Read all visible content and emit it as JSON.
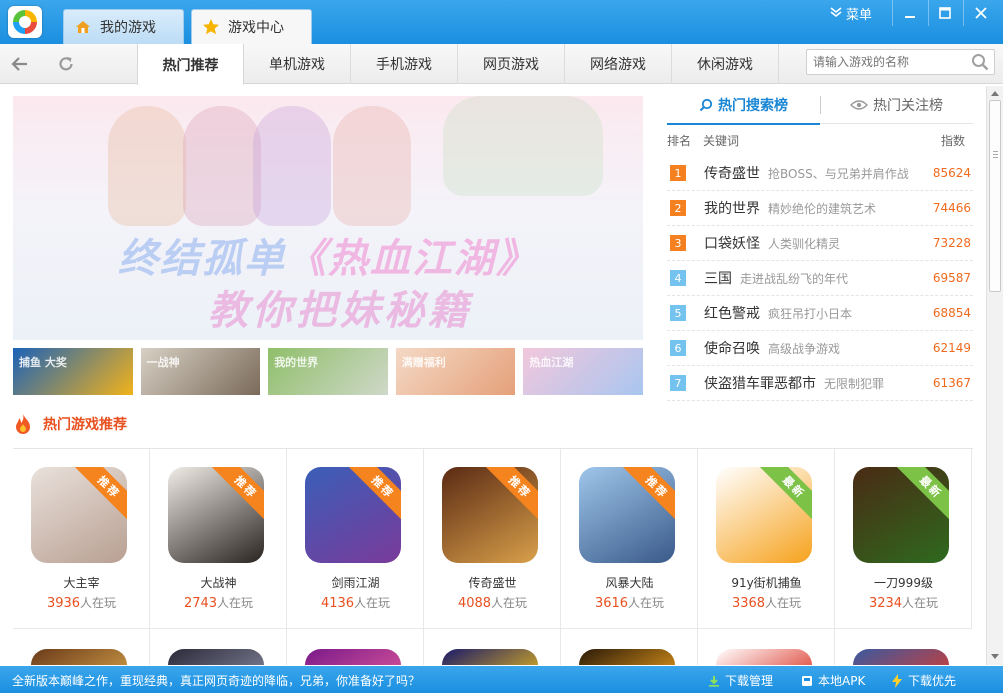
{
  "titlebar": {
    "tabs": [
      {
        "label": "我的游戏"
      },
      {
        "label": "游戏中心"
      }
    ],
    "menu_label": "菜单"
  },
  "nav": {
    "tabs": [
      "热门推荐",
      "单机游戏",
      "手机游戏",
      "网页游戏",
      "网络游戏",
      "休闲游戏"
    ],
    "search_placeholder": "请输入游戏的名称"
  },
  "banner": {
    "line1_a": "终结孤单",
    "line1_b": "《热血江湖》",
    "line2": "教你把妹秘籍"
  },
  "thumbs": [
    {
      "text": "捕鱼 大奖",
      "color1": "#1b62b8",
      "color2": "#f2b21a"
    },
    {
      "text": "一战神",
      "color1": "#d7d0c4",
      "color2": "#7a6a5a"
    },
    {
      "text": "我的世界",
      "color1": "#8fbf6a",
      "color2": "#cfd8c8"
    },
    {
      "text": "满赠福利",
      "color1": "#f4d9c5",
      "color2": "#e5a07a"
    },
    {
      "text": "热血江湖",
      "color1": "#f2c7dc",
      "color2": "#a9c6ef"
    }
  ],
  "ranking": {
    "tab_active": "热门搜索榜",
    "tab_inactive": "热门关注榜",
    "col_rank": "排名",
    "col_keyword": "关键词",
    "col_index": "指数",
    "items": [
      {
        "rank": "1",
        "name": "传奇盛世",
        "desc": "抢BOSS、与兄弟并肩作战",
        "score": "85624",
        "hot": true
      },
      {
        "rank": "2",
        "name": "我的世界",
        "desc": "精妙绝伦的建筑艺术",
        "score": "74466",
        "hot": true
      },
      {
        "rank": "3",
        "name": "口袋妖怪",
        "desc": "人类驯化精灵",
        "score": "73228",
        "hot": true
      },
      {
        "rank": "4",
        "name": "三国",
        "desc": "走进战乱纷飞的年代",
        "score": "69587",
        "hot": false
      },
      {
        "rank": "5",
        "name": "红色警戒",
        "desc": "疯狂吊打小日本",
        "score": "68854",
        "hot": false
      },
      {
        "rank": "6",
        "name": "使命召唤",
        "desc": "高级战争游戏",
        "score": "62149",
        "hot": false
      },
      {
        "rank": "7",
        "name": "侠盗猎车罪恶都市",
        "desc": "无限制犯罪",
        "score": "61367",
        "hot": false
      }
    ]
  },
  "hot": {
    "title": "热门游戏推荐",
    "playing_suffix": "人在玩",
    "games": [
      {
        "name": "大主宰",
        "count": "3936",
        "ribbon": "推荐",
        "ribbon_type": "rec",
        "c1": "#e9e1db",
        "c2": "#b89f92"
      },
      {
        "name": "大战神",
        "count": "2743",
        "ribbon": "推荐",
        "ribbon_type": "rec",
        "c1": "#f0ece6",
        "c2": "#2a2420"
      },
      {
        "name": "剑雨江湖",
        "count": "4136",
        "ribbon": "推荐",
        "ribbon_type": "rec",
        "c1": "#3a5fb8",
        "c2": "#7a3a9a"
      },
      {
        "name": "传奇盛世",
        "count": "4088",
        "ribbon": "推荐",
        "ribbon_type": "rec",
        "c1": "#5a2a14",
        "c2": "#d9a04a"
      },
      {
        "name": "风暴大陆",
        "count": "3616",
        "ribbon": "推荐",
        "ribbon_type": "rec",
        "c1": "#9fc6ea",
        "c2": "#3a5a8a"
      },
      {
        "name": "91y街机捕鱼",
        "count": "3368",
        "ribbon": "最新",
        "ribbon_type": "new",
        "c1": "#ffffff",
        "c2": "#f6a21c"
      },
      {
        "name": "一刀999级",
        "count": "3234",
        "ribbon": "最新",
        "ribbon_type": "new",
        "c1": "#4a2a14",
        "c2": "#2e6a1e"
      }
    ],
    "row2_colors": [
      {
        "c1": "#6a3a1a",
        "c2": "#d9a64a"
      },
      {
        "c1": "#2a2a3a",
        "c2": "#8a8aa0"
      },
      {
        "c1": "#7a1a8a",
        "c2": "#e05a9a"
      },
      {
        "c1": "#1a1a6a",
        "c2": "#f2c21a"
      },
      {
        "c1": "#2a1a0a",
        "c2": "#f2a21a"
      },
      {
        "c1": "#ffffff",
        "c2": "#d9291a"
      },
      {
        "c1": "#3a5aa0",
        "c2": "#e03a2a"
      }
    ]
  },
  "statusbar": {
    "message": "全新版本巅峰之作，重现经典，真正网页奇迹的降临，兄弟，你准备好了吗？",
    "download_mgr": "下载管理",
    "local_apk": "本地APK",
    "download_first": "下载优先"
  }
}
